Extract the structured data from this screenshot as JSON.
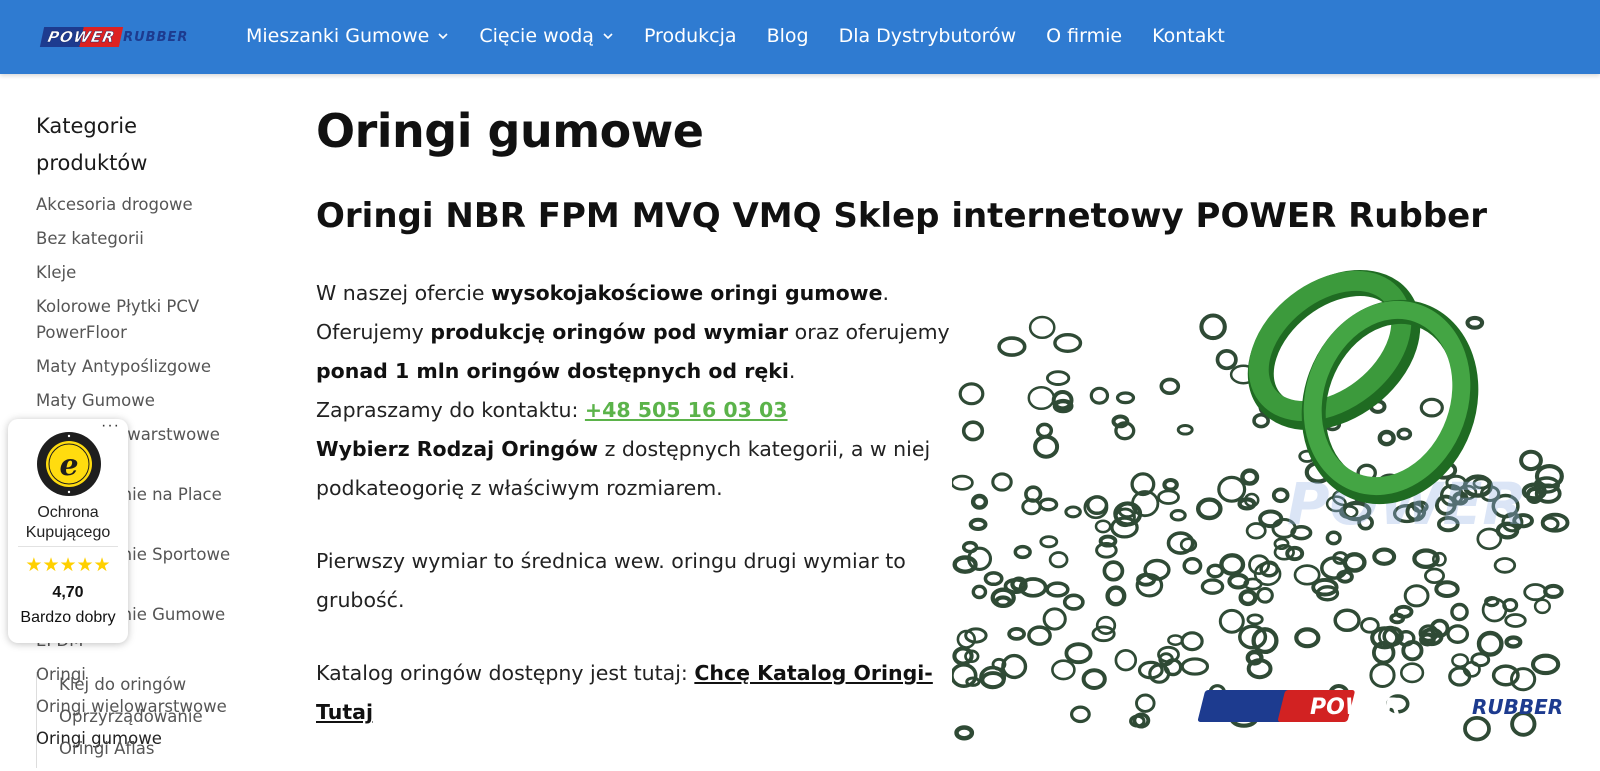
{
  "header": {
    "logo": {
      "part1": "POWER",
      "part2": "RUBBER"
    },
    "nav": [
      {
        "label": "Mieszanki Gumowe",
        "dropdown": true
      },
      {
        "label": "Cięcie wodą",
        "dropdown": true
      },
      {
        "label": "Produkcja",
        "dropdown": false
      },
      {
        "label": "Blog",
        "dropdown": false
      },
      {
        "label": "Dla Dystrybutorów",
        "dropdown": false
      },
      {
        "label": "O firmie",
        "dropdown": false
      },
      {
        "label": "Kontakt",
        "dropdown": false
      }
    ],
    "color": "#2f7bd1"
  },
  "sidebar": {
    "title": "Kategorie produktów",
    "categories": [
      "Akcesoria drogowe",
      "Bez kategorii",
      "Kleje",
      "Kolorowe Płytki PCV PowerFloor",
      "Maty Antypoślizgowe",
      "Maty Gumowe",
      "Maty Wielowarstwowe Wylewane",
      "Nawierzchnie na Place Zabaw",
      "Nawierzchnie Sportowe Równie",
      "Nawierzchnie Gumowe EPDM",
      "Oringi",
      "Oringi wielowarstwowe",
      "Oringi gumowe"
    ],
    "subcategories": [
      "Klej do oringów",
      "Oprzyrządowanie",
      "Oringi Aflas"
    ]
  },
  "trust_badge": {
    "seal_icon": "trusted-shops-seal-icon",
    "protection": "Ochrona Kupującego",
    "stars": "★★★★★",
    "rating": "4,70",
    "rating_label": "Bardzo dobry"
  },
  "main": {
    "title": "Oringi gumowe",
    "subtitle": "Oringi NBR FPM MVQ VMQ Sklep internetowy POWER Rubber",
    "p1": {
      "t1": "W naszej ofercie ",
      "b1": "wysokojakościowe oringi gumowe",
      "t2": ".",
      "t3": "Oferujemy ",
      "b2": "produkcję oringów pod wymiar",
      "t4": " oraz oferujemy ",
      "b3": "ponad 1 mln oringów dostępnych od ręki",
      "t5": ".",
      "t6": "Zapraszamy do kontaktu: ",
      "phone": "+48 505 16 03 03",
      "b4": "Wybierz Rodzaj Oringów",
      "t7": " z dostępnych kategorii, a w niej podkateogorię z właściwym rozmiarem."
    },
    "p2": "Pierwszy wymiar to średnica wew. oringu drugi wymiar to grubość.",
    "p3": {
      "t1": "Katalog oringów dostępny jest tutaj: ",
      "link": "Chcę Katalog Oringi-Tutaj"
    }
  },
  "product_image": {
    "watermark": "POWER",
    "logo_part1": "POWER",
    "logo_part2": "RUBBER"
  },
  "colors": {
    "accent": "#2f7bd1",
    "phone": "#5bb34a",
    "oring_green": "#2e7d2e",
    "oring_dark": "#2f4a35"
  }
}
